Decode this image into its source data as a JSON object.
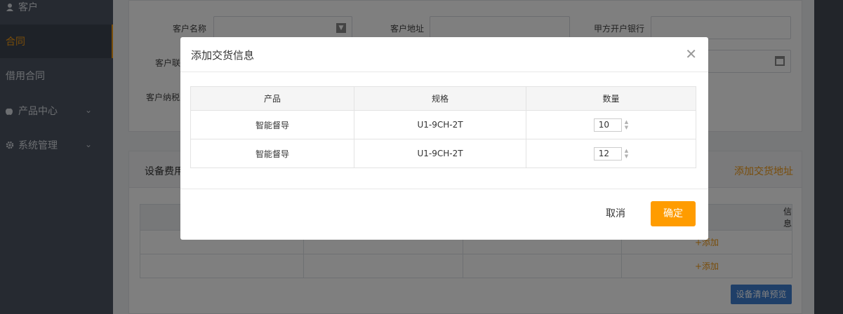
{
  "sidebar": {
    "items": [
      {
        "label": "客户",
        "icon": "user-icon"
      },
      {
        "label": "合同",
        "icon": ""
      },
      {
        "label": "借用合同",
        "icon": ""
      },
      {
        "label": "产品中心",
        "icon": "apple-icon"
      },
      {
        "label": "系统管理",
        "icon": "gear-icon"
      }
    ],
    "active_index": 1
  },
  "form": {
    "customer_name_label": "客户名称",
    "customer_address_label": "客户地址",
    "bank_label": "甲方开户银行",
    "contact_label": "客户联系",
    "taxpayer_label": "客户纳税人"
  },
  "section": {
    "title": "设备费用",
    "add_address": "添加交货地址",
    "info_header": "信息",
    "add_link": "+添加",
    "preview_button": "设备清单预览"
  },
  "modal": {
    "title": "添加交货信息",
    "columns": [
      "产品",
      "规格",
      "数量"
    ],
    "rows": [
      {
        "product": "智能督导",
        "spec": "U1-9CH-2T",
        "qty": "10"
      },
      {
        "product": "智能督导",
        "spec": "U1-9CH-2T",
        "qty": "12"
      }
    ],
    "cancel": "取消",
    "confirm": "确定"
  },
  "colors": {
    "accent": "#f29a15",
    "confirm_button": "#ff9c00",
    "sidebar_bg": "#4c5563",
    "preview_button": "#3f7fd0"
  }
}
